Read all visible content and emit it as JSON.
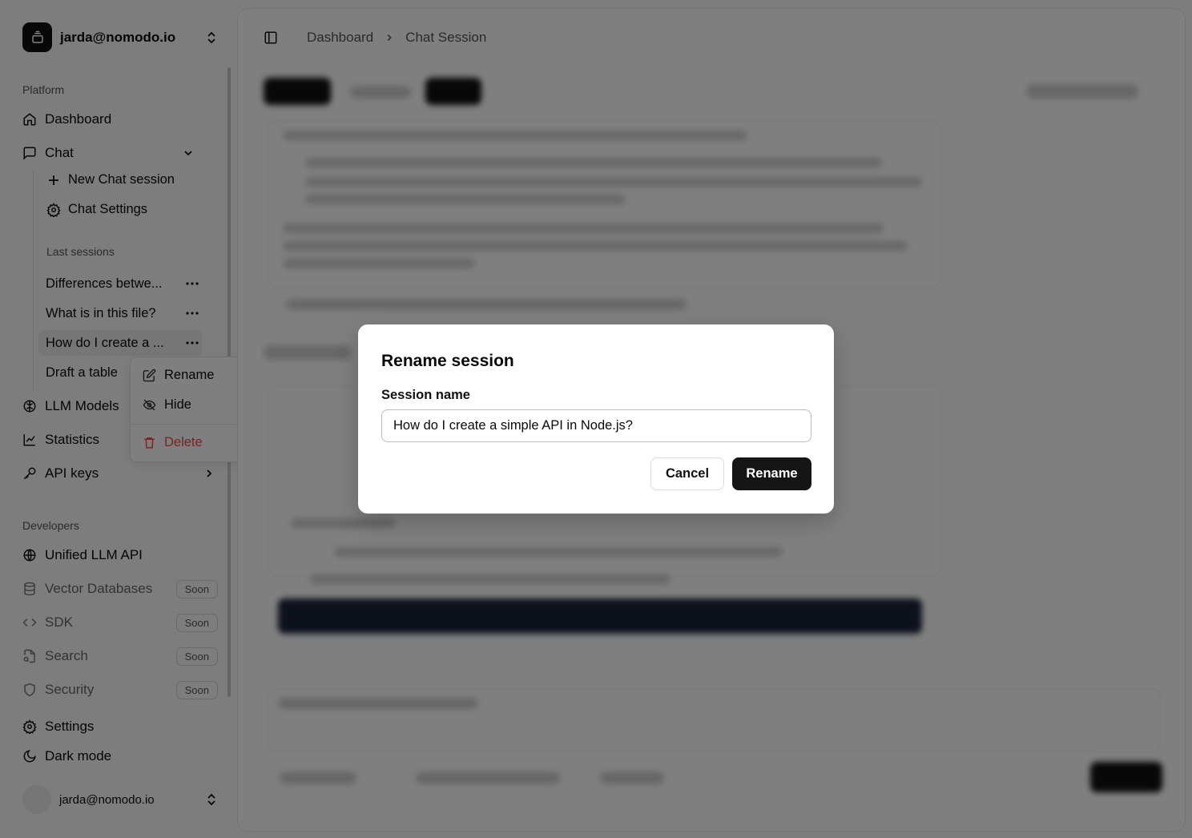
{
  "workspace": {
    "name": "jarda@nomodo.io"
  },
  "sidebar": {
    "platform_label": "Platform",
    "dashboard": "Dashboard",
    "chat": "Chat",
    "chat_sub": {
      "new_session": "New Chat session",
      "settings": "Chat Settings",
      "last_sessions_label": "Last sessions",
      "sessions": [
        "Differences betwe...",
        "What is in this file?",
        "How do I create a ...",
        "Draft a table"
      ]
    },
    "llm_models": "LLM Models",
    "statistics": "Statistics",
    "api_keys": "API keys",
    "developers_label": "Developers",
    "unified_api": "Unified LLM API",
    "vector_db": "Vector Databases",
    "sdk": "SDK",
    "search": "Search",
    "security": "Security",
    "soon": "Soon",
    "settings": "Settings",
    "dark_mode": "Dark mode"
  },
  "context_menu": {
    "rename": "Rename",
    "hide": "Hide",
    "delete": "Delete"
  },
  "breadcrumb": {
    "root": "Dashboard",
    "current": "Chat Session"
  },
  "user": {
    "email": "jarda@nomodo.io"
  },
  "dialog": {
    "title": "Rename session",
    "field_label": "Session name",
    "field_value": "How do I create a simple API in Node.js?",
    "cancel": "Cancel",
    "confirm": "Rename"
  },
  "colors": {
    "danger": "#e64b4b",
    "primary": "#151515"
  }
}
